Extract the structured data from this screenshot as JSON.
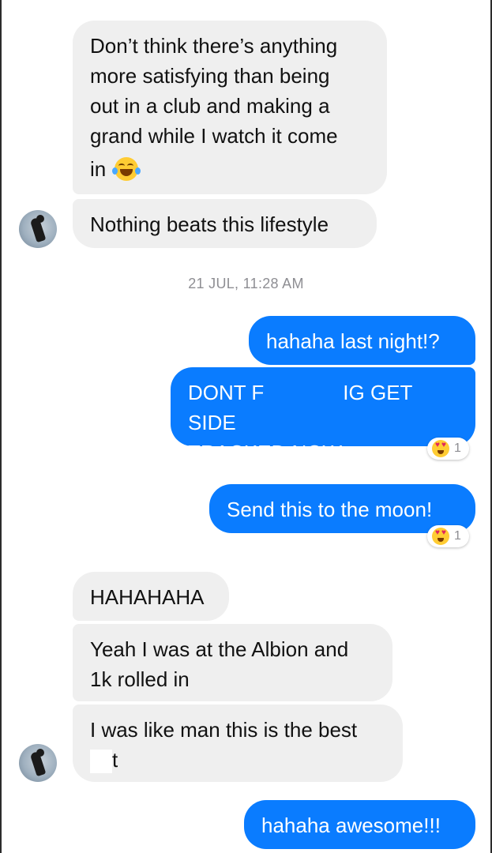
{
  "messages": {
    "m1": {
      "line1": "Don’t think there’s anything",
      "line2": "more satisfying than being",
      "line3": "out in a club and making a",
      "line4": "grand while I watch it come",
      "line5": "in",
      "emoji": "face-with-tears-of-joy-icon"
    },
    "m2": "Nothing beats this lifestyle",
    "timestamp": "21 JUL, 11:28 AM",
    "m3": "hahaha last night!?",
    "m4": {
      "part1": "DONT F",
      "part2": "IG GET SIDE",
      "line2": "TRACKED NOW",
      "reaction_count": "1",
      "reaction_emoji": "smiling-face-with-heart-eyes-icon"
    },
    "m5": {
      "text": "Send this to the moon!",
      "reaction_count": "1",
      "reaction_emoji": "smiling-face-with-heart-eyes-icon"
    },
    "m6": "HAHAHAHA",
    "m7": {
      "line1": "Yeah I was at the Albion and",
      "line2": "1k rolled in"
    },
    "m8": {
      "line1": "I was like man this is the best",
      "line2_tail": "t"
    },
    "m9": "hahaha awesome!!!"
  },
  "colors": {
    "incoming_bubble": "#efefef",
    "outgoing_bubble": "#0a7cff",
    "timestamp_text": "#8e8e93"
  }
}
